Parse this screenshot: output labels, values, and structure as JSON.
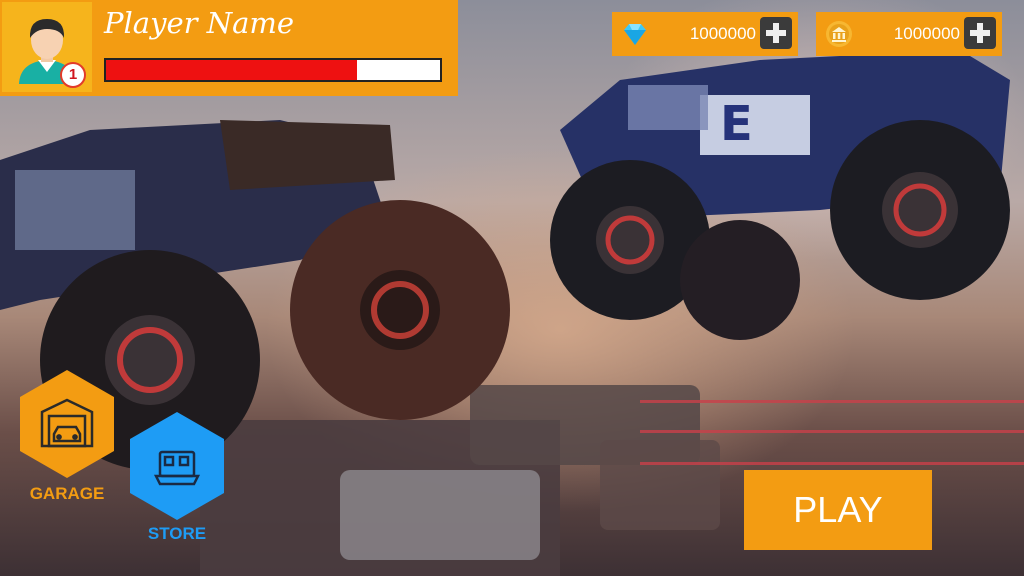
{
  "player": {
    "name": "Player Name",
    "level": "1",
    "xp_progress": 0.75,
    "avatar_icon": "player-avatar-icon"
  },
  "currencies": [
    {
      "id": "gems",
      "icon": "gem-icon",
      "amount": "1000000",
      "add_icon": "plus-icon"
    },
    {
      "id": "coins",
      "icon": "coin-icon",
      "amount": "1000000",
      "add_icon": "plus-icon"
    }
  ],
  "menu": {
    "garage_label": "GARAGE",
    "garage_icon": "garage-icon",
    "store_label": "STORE",
    "store_icon": "store-icon"
  },
  "play_label": "PLAY",
  "colors": {
    "accent": "#f39c12",
    "hud_header": "#f39c12",
    "xp_fill": "#ee1111",
    "store": "#1e9cf5",
    "garage": "#f39c12",
    "plus_button": "#3b3b3b"
  }
}
